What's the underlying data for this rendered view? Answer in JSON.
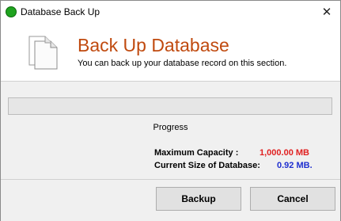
{
  "window": {
    "title": "Database Back Up",
    "close_glyph": "✕"
  },
  "header": {
    "title": "Back Up Database",
    "subtitle": "You can back up your database record on this section.",
    "icon": "documents-icon"
  },
  "progress": {
    "label": "Progress",
    "value_percent": 0
  },
  "info": {
    "max_capacity_label": "Maximum Capacity :",
    "max_capacity_value": "1,000.00 MB",
    "current_size_label": "Current Size of Database:",
    "current_size_value": "0.92 MB."
  },
  "buttons": {
    "backup": "Backup",
    "cancel": "Cancel"
  },
  "colors": {
    "header_title": "#c04a0f",
    "capacity_value": "#e02020",
    "size_value": "#1f2fd0",
    "title_dot": "#1fa31f"
  }
}
